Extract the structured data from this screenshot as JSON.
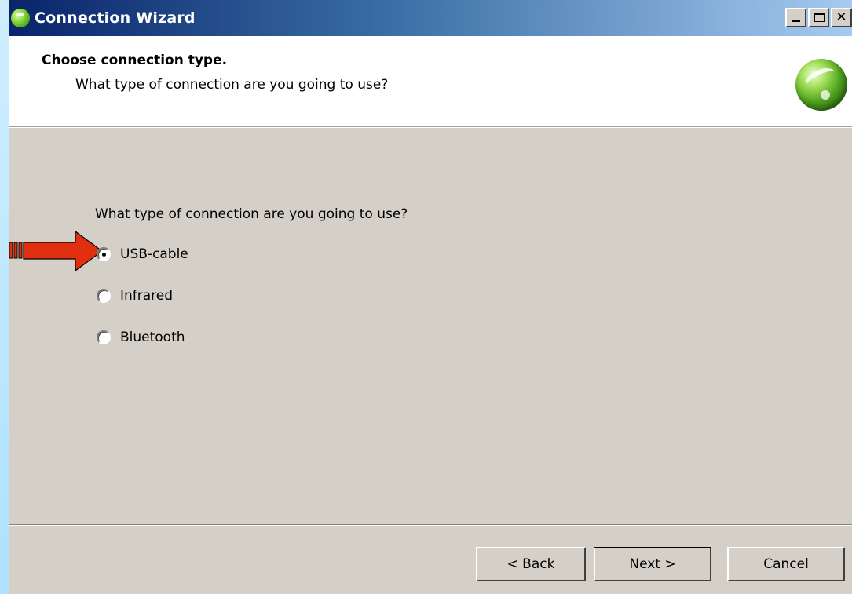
{
  "window": {
    "title": "Connection Wizard",
    "controls": {
      "minimize": "minimize",
      "maximize": "maximize",
      "close": "✕"
    }
  },
  "header": {
    "title": "Choose connection type.",
    "subtitle": "What type of connection are you going to use?"
  },
  "main": {
    "question": "What type of connection are you going to use?",
    "options": [
      {
        "label": "USB-cable",
        "selected": true
      },
      {
        "label": "Infrared",
        "selected": false
      },
      {
        "label": "Bluetooth",
        "selected": false
      }
    ]
  },
  "annotation": {
    "arrow_color": "#e03010",
    "icon": "red-arrow-icon"
  },
  "footer": {
    "back_label": "< Back",
    "next_label": "Next >",
    "cancel_label": "Cancel"
  },
  "colors": {
    "title_gradient_start": "#0a246a",
    "title_gradient_end": "#a6caf0",
    "dialog_face": "#d4d0c8",
    "logo_green": "#4fa31e"
  }
}
